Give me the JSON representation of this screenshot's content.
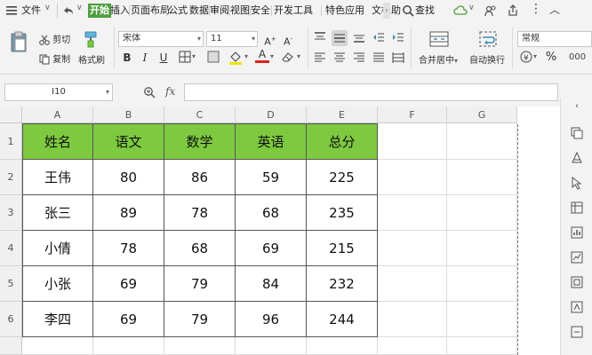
{
  "menu": {
    "file": "文件",
    "start": "开始",
    "insert": "插入",
    "layout": "页面布局",
    "formula": "公式",
    "data": "数据",
    "review": "审阅",
    "view": "视图",
    "security": "安全",
    "dev": "开发工具",
    "special": "特色应用",
    "docbox": "文档助",
    "search": "查找"
  },
  "ribbon": {
    "cut": "剪切",
    "copy": "复制",
    "format_painter": "格式刷",
    "font_name": "宋体",
    "font_size": "11",
    "merge_center": "合并居中",
    "wrap_text": "自动换行",
    "number_format": "常规",
    "percent": "%"
  },
  "formula_bar": {
    "name_box": "I10",
    "fx": "fx"
  },
  "columns": [
    "A",
    "B",
    "C",
    "D",
    "E",
    "F",
    "G"
  ],
  "rows": [
    "1",
    "2",
    "3",
    "4",
    "5",
    "6"
  ],
  "table": {
    "headers": [
      "姓名",
      "语文",
      "数学",
      "英语",
      "总分"
    ],
    "data": [
      [
        "王伟",
        "80",
        "86",
        "59",
        "225"
      ],
      [
        "张三",
        "89",
        "78",
        "68",
        "235"
      ],
      [
        "小倩",
        "78",
        "68",
        "69",
        "215"
      ],
      [
        "小张",
        "69",
        "79",
        "84",
        "232"
      ],
      [
        "李四",
        "69",
        "79",
        "96",
        "244"
      ]
    ]
  },
  "colors": {
    "header_fill": "#7dc940",
    "active_tab": "#4e9f3d"
  }
}
